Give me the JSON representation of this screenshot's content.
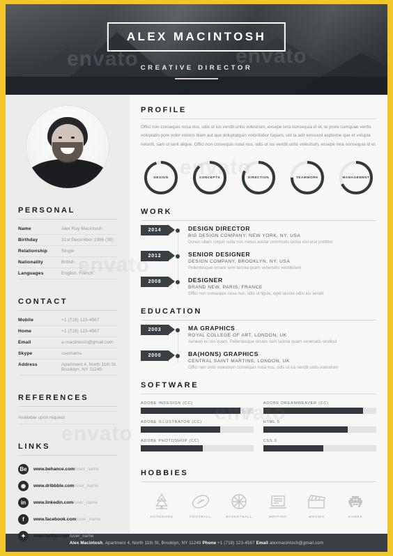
{
  "header": {
    "name": "ALEX MACINTOSH",
    "role": "CREATIVE DIRECTOR"
  },
  "sidebar": {
    "personal_title": "PERSONAL",
    "personal": [
      {
        "label": "Name",
        "value": "Alex Ray Macintosh"
      },
      {
        "label": "Birthday",
        "value": "31st December 1986 (30)"
      },
      {
        "label": "Relationship",
        "value": "Single"
      },
      {
        "label": "Nationality",
        "value": "British"
      },
      {
        "label": "Languages",
        "value": "English, French"
      }
    ],
    "contact_title": "CONTACT",
    "contact": [
      {
        "label": "Mobile",
        "value": "+1 (718) 123-4567"
      },
      {
        "label": "Home",
        "value": "+1 (718) 123-4567"
      },
      {
        "label": "Email",
        "value": "a-mactintosh@gmail.com"
      },
      {
        "label": "Skype",
        "value": "username"
      }
    ],
    "address_label": "Address",
    "address_line1": "Apartment 4, North 11th St",
    "address_line2": "Brooklyn, NY 11249",
    "references_title": "REFERENCES",
    "references_note": "Available upon request",
    "links_title": "LINKS",
    "links": [
      {
        "icon": "behance-icon",
        "glyph": "Be",
        "domain": "www.behance.com",
        "user": "/user_name"
      },
      {
        "icon": "dribbble-icon",
        "glyph": "◉",
        "domain": "www.dribbble.com",
        "user": "/user_name"
      },
      {
        "icon": "linkedin-icon",
        "glyph": "in",
        "domain": "www.linkedin.com",
        "user": "/user_name"
      },
      {
        "icon": "facebook-icon",
        "glyph": "f",
        "domain": "www.facebook.com",
        "user": "/user_name"
      },
      {
        "icon": "twitter-icon",
        "glyph": "✦",
        "domain": "www.twitter.com",
        "user": "/user_name"
      }
    ]
  },
  "main": {
    "profile_title": "PROFILE",
    "profile_text": "Offici non consequis nosa nus, odis ut ius vendit untis volestrum, exsepe rera nonsequia id et, te prore cumquae ventis voluptatin pore volor volorro blam aut que doluptatquin volonitatior fugiam, unt la adit eossood asptiome que et volupta necerit, sam ut lanit alique. Offici non consequis nosa nus, odis ut ius vendit untis volestrum, exsepe rera nonsequia id et.",
    "skills": [
      {
        "label": "DESIGN",
        "value": 95
      },
      {
        "label": "CONCEPTS",
        "value": 88
      },
      {
        "label": "DIRECTION",
        "value": 82
      },
      {
        "label": "TEAMWORK",
        "value": 75
      },
      {
        "label": "MANAGEMENT",
        "value": 68
      }
    ],
    "work_title": "WORK",
    "work": [
      {
        "year": "2014",
        "title": "DESIGN DIRECTOR",
        "place": "BIG DESIGN COMPANY, NEW YORK, NY, USA",
        "desc": "Donec ullam corper nulla non metus auctor commodo luctus nisi erat porttitor"
      },
      {
        "year": "2012",
        "title": "SENIOR DESIGNER",
        "place": "DESIGN COMPANY, BROOKLYN, NY, USA",
        "desc": "Pellentesque ornare sem lacinia quam venenatis vestibulum"
      },
      {
        "year": "2008",
        "title": "DESIGNER",
        "place": "BRAND NEW, PARIS, FRANCE",
        "desc": "Offici non consequis nosa nus, odis ut ligula, eget lacinia odiis ius vendit"
      }
    ],
    "education_title": "EDUCATION",
    "education": [
      {
        "year": "2003",
        "title": "MA GRAPHICS",
        "place": "ROYAL COLLEGE OF ART, LONDON, UK",
        "desc": "Aenean eu leo quam. Pellentesque ornare sem lacinia quam venenatis vestibul"
      },
      {
        "year": "2000",
        "title": "BA(HONS) GRAPHICS",
        "place": "CENTRAL SAINT MARTINS, LONDON, UK",
        "desc": "Offici non untis volestrum consequis nosa nus, odis ut ius vendit untis volestrum"
      }
    ],
    "software_title": "SOFTWARE",
    "software": [
      {
        "label": "ADOBE INDESIGN (CC)",
        "value": 88
      },
      {
        "label": "ADOBE DREAMWEAVER (CC)",
        "value": 88
      },
      {
        "label": "ADOBE ILLUSTRATOR (CC)",
        "value": 70
      },
      {
        "label": "HTML 5",
        "value": 75
      },
      {
        "label": "ADOBE PHOTOSHOP (CC)",
        "value": 55
      },
      {
        "label": "CSS 3",
        "value": 53
      }
    ],
    "hobbies_title": "HOBBIES",
    "hobbies": [
      {
        "icon": "trees-icon",
        "label": "OUTDOORS"
      },
      {
        "icon": "football-icon",
        "label": "FOOTBALL"
      },
      {
        "icon": "basketball-icon",
        "label": "BASKETBALL"
      },
      {
        "icon": "laptop-icon",
        "label": "WRITING"
      },
      {
        "icon": "clapperboard-icon",
        "label": "MOVIES"
      },
      {
        "icon": "space-invader-icon",
        "label": "GAMES"
      }
    ]
  },
  "footer": {
    "name": "Alex Macintosh",
    "address": ", Apartment 4, North 11th St, Brooklyn, NY 11249  ",
    "phone_label": "Phone",
    "phone": " +1 (718) 123-4567  ",
    "email_label": "Email",
    "email": " alexmacintosh@gmail.com"
  },
  "watermark": "envato",
  "colors": {
    "gold": "#f0c62a",
    "dark": "#3a3f44",
    "bar": "#33383d"
  }
}
